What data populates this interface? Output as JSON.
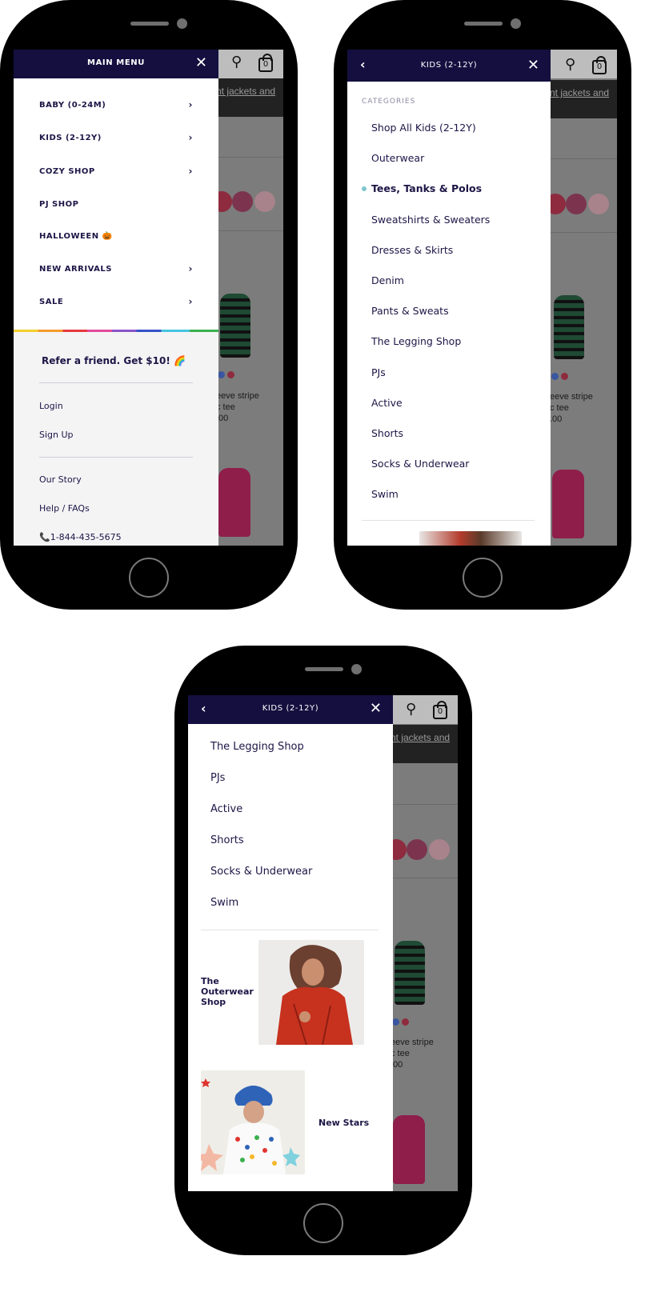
{
  "background_page": {
    "banner_text": "nt jackets and",
    "product_text": [
      "eeve stripe",
      "c tee",
      ".00"
    ],
    "bag_count": "0"
  },
  "phone1": {
    "header_title": "MAIN MENU",
    "menu_items": [
      {
        "label": "BABY (0-24M)",
        "has_arrow": true
      },
      {
        "label": "KIDS (2-12Y)",
        "has_arrow": true
      },
      {
        "label": "COZY SHOP",
        "has_arrow": true
      },
      {
        "label": "PJ SHOP",
        "has_arrow": false
      },
      {
        "label": "HALLOWEEN 🎃",
        "has_arrow": false
      },
      {
        "label": "NEW ARRIVALS",
        "has_arrow": true
      },
      {
        "label": "SALE",
        "has_arrow": true
      }
    ],
    "referral": "Refer a friend. Get $10! 🌈",
    "login": "Login",
    "signup": "Sign Up",
    "our_story": "Our Story",
    "help": "Help / FAQs",
    "phone": "1-844-435-5675"
  },
  "phone2": {
    "header_title": "KIDS (2-12Y)",
    "categories_label": "CATEGORIES",
    "categories": [
      "Shop All Kids (2-12Y)",
      "Outerwear",
      "Tees, Tanks & Polos",
      "Sweatshirts & Sweaters",
      "Dresses & Skirts",
      "Denim",
      "Pants & Sweats",
      "The Legging Shop",
      "PJs",
      "Active",
      "Shorts",
      "Socks & Underwear",
      "Swim"
    ],
    "active_category": "Tees, Tanks & Polos"
  },
  "phone3": {
    "header_title": "KIDS (2-12Y)",
    "categories": [
      "The Legging Shop",
      "PJs",
      "Active",
      "Shorts",
      "Socks & Underwear",
      "Swim"
    ],
    "promo1_title": "The Outerwear Shop",
    "promo2_title": "New Stars"
  },
  "colors": {
    "header_bg": "#140f3f",
    "text": "#1c1646",
    "active_dot": "#7fc6cf"
  },
  "icons": [
    "close-icon",
    "back-icon",
    "chevron-right-icon",
    "search-icon",
    "bag-icon",
    "phone-icon"
  ]
}
